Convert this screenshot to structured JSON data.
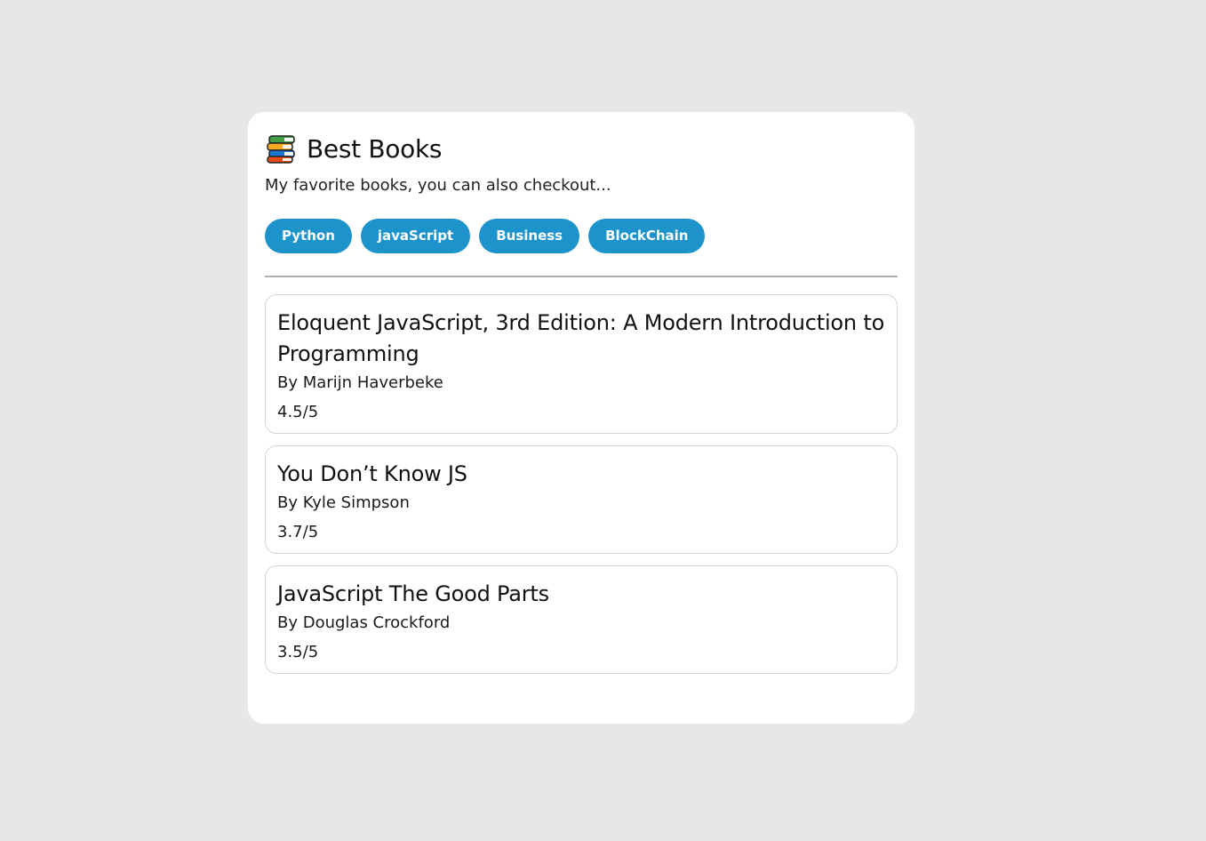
{
  "header": {
    "icon": "books-icon",
    "title": "Best Books",
    "subtitle": "My favorite books, you can also checkout..."
  },
  "tags": [
    {
      "label": "Python"
    },
    {
      "label": "javaScript"
    },
    {
      "label": "Business"
    },
    {
      "label": "BlockChain"
    }
  ],
  "colors": {
    "background": "#e7e7e7",
    "card": "#ffffff",
    "tag": "#1d93cc",
    "divider": "#b0b0b0"
  },
  "books": [
    {
      "title": "Eloquent JavaScript, 3rd Edition: A Modern Introduction to Programming",
      "author": "By Marijn Haverbeke",
      "rating": "4.5/5"
    },
    {
      "title": "You Don’t Know JS",
      "author": "By Kyle Simpson",
      "rating": "3.7/5"
    },
    {
      "title": "JavaScript The Good Parts",
      "author": "By Douglas Crockford",
      "rating": "3.5/5"
    }
  ]
}
